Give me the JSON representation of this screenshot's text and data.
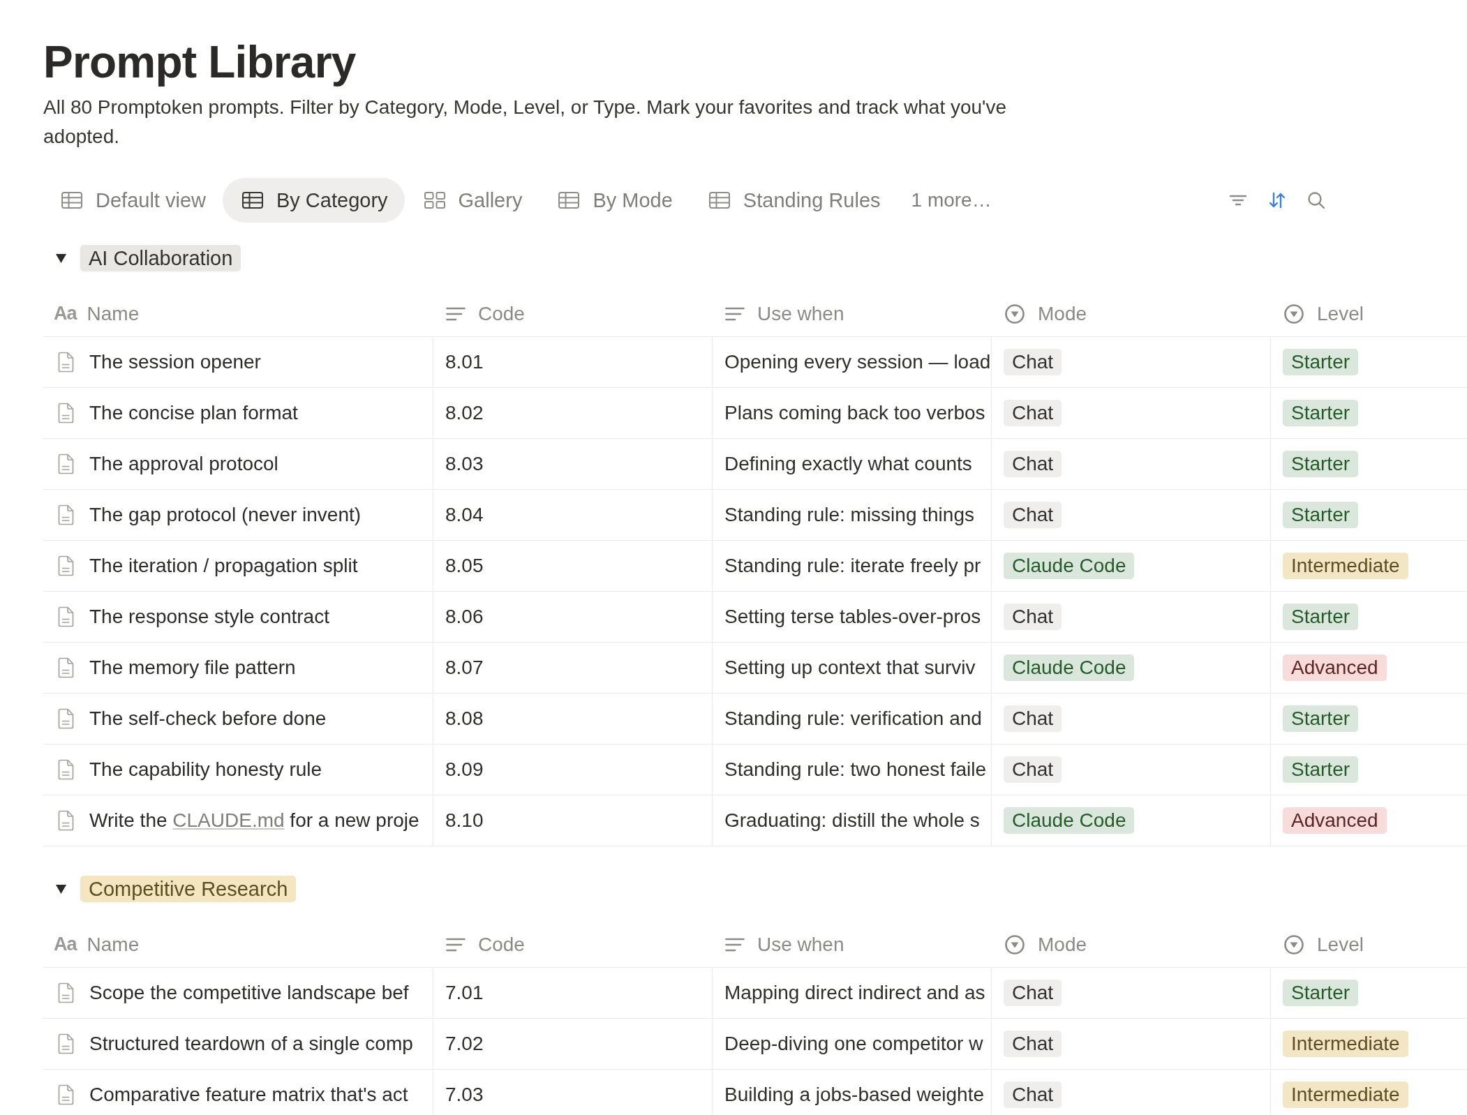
{
  "page": {
    "title": "Prompt Library",
    "description": "All 80 Promptoken prompts. Filter by Category, Mode, Level, or Type. Mark your favorites and track what you've adopted."
  },
  "views": [
    {
      "label": "Default view",
      "kind": "table",
      "selected": false
    },
    {
      "label": "By Category",
      "kind": "table",
      "selected": true
    },
    {
      "label": "Gallery",
      "kind": "gallery",
      "selected": false
    },
    {
      "label": "By Mode",
      "kind": "table",
      "selected": false
    },
    {
      "label": "Standing Rules",
      "kind": "table",
      "selected": false
    }
  ],
  "more_views": "1 more…",
  "toolbar": {
    "sort_active": true
  },
  "groups": [
    {
      "label": "AI Collaboration",
      "color": "#e8e7e4",
      "expanded": true,
      "columns": [
        {
          "label": "Name",
          "kind": "title",
          "glyph": "Aa"
        },
        {
          "label": "Code",
          "kind": "text"
        },
        {
          "label": "Use when",
          "kind": "text"
        },
        {
          "label": "Mode",
          "kind": "select"
        },
        {
          "label": "Level",
          "kind": "select"
        }
      ],
      "rows": [
        {
          "name": "The session opener",
          "code": "8.01",
          "use_when": "Opening every session — load",
          "mode": {
            "label": "Chat",
            "color": "#efeeec"
          },
          "level": {
            "label": "Starter",
            "color": "#dbe7dc"
          }
        },
        {
          "name": "The concise plan format",
          "code": "8.02",
          "use_when": "Plans coming back too verbos",
          "mode": {
            "label": "Chat",
            "color": "#efeeec"
          },
          "level": {
            "label": "Starter",
            "color": "#dbe7dc"
          }
        },
        {
          "name": "The approval protocol",
          "code": "8.03",
          "use_when": "Defining exactly what counts",
          "mode": {
            "label": "Chat",
            "color": "#efeeec"
          },
          "level": {
            "label": "Starter",
            "color": "#dbe7dc"
          }
        },
        {
          "name": "The gap protocol (never invent)",
          "code": "8.04",
          "use_when": "Standing rule: missing things",
          "mode": {
            "label": "Chat",
            "color": "#efeeec"
          },
          "level": {
            "label": "Starter",
            "color": "#dbe7dc"
          }
        },
        {
          "name": "The iteration / propagation split",
          "code": "8.05",
          "use_when": "Standing rule: iterate freely pr",
          "mode": {
            "label": "Claude Code",
            "color": "#dbe7dc"
          },
          "level": {
            "label": "Intermediate",
            "color": "#f2e6c4"
          }
        },
        {
          "name": "The response style contract",
          "code": "8.06",
          "use_when": "Setting terse tables-over-pros",
          "mode": {
            "label": "Chat",
            "color": "#efeeec"
          },
          "level": {
            "label": "Starter",
            "color": "#dbe7dc"
          }
        },
        {
          "name": "The memory file pattern",
          "code": "8.07",
          "use_when": "Setting up context that surviv",
          "mode": {
            "label": "Claude Code",
            "color": "#dbe7dc"
          },
          "level": {
            "label": "Advanced",
            "color": "#f8dcdb"
          }
        },
        {
          "name": "The self-check before done",
          "code": "8.08",
          "use_when": "Standing rule: verification and",
          "mode": {
            "label": "Chat",
            "color": "#efeeec"
          },
          "level": {
            "label": "Starter",
            "color": "#dbe7dc"
          }
        },
        {
          "name": "The capability honesty rule",
          "code": "8.09",
          "use_when": "Standing rule: two honest faile",
          "mode": {
            "label": "Chat",
            "color": "#efeeec"
          },
          "level": {
            "label": "Starter",
            "color": "#dbe7dc"
          }
        },
        {
          "name": [
            {
              "kind": "text",
              "text": "Write the "
            },
            {
              "kind": "link",
              "text": "CLAUDE.md"
            },
            {
              "kind": "text",
              "text": " for a new proje"
            }
          ],
          "code": "8.10",
          "use_when": "Graduating: distill the whole s",
          "mode": {
            "label": "Claude Code",
            "color": "#dbe7dc"
          },
          "level": {
            "label": "Advanced",
            "color": "#f8dcdb"
          }
        }
      ]
    },
    {
      "label": "Competitive Research",
      "color": "#f3e6c0",
      "expanded": true,
      "columns": [
        {
          "label": "Name",
          "kind": "title",
          "glyph": "Aa"
        },
        {
          "label": "Code",
          "kind": "text"
        },
        {
          "label": "Use when",
          "kind": "text"
        },
        {
          "label": "Mode",
          "kind": "select"
        },
        {
          "label": "Level",
          "kind": "select"
        }
      ],
      "rows": [
        {
          "name": "Scope the competitive landscape bef",
          "code": "7.01",
          "use_when": "Mapping direct indirect and as",
          "mode": {
            "label": "Chat",
            "color": "#efeeec"
          },
          "level": {
            "label": "Starter",
            "color": "#dbe7dc"
          }
        },
        {
          "name": "Structured teardown of a single comp",
          "code": "7.02",
          "use_when": "Deep-diving one competitor w",
          "mode": {
            "label": "Chat",
            "color": "#efeeec"
          },
          "level": {
            "label": "Intermediate",
            "color": "#f2e6c4"
          }
        },
        {
          "name": "Comparative feature matrix that's act",
          "code": "7.03",
          "use_when": "Building a jobs-based weighte",
          "mode": {
            "label": "Chat",
            "color": "#efeeec"
          },
          "level": {
            "label": "Intermediate",
            "color": "#f2e6c4"
          }
        }
      ]
    }
  ]
}
